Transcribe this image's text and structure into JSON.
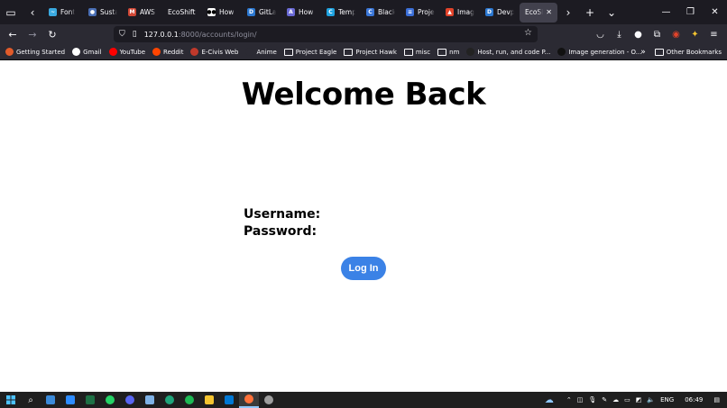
{
  "browser": {
    "tabs": [
      {
        "title": "Font",
        "color": "#3aa9e0",
        "glyph": "~"
      },
      {
        "title": "Susta",
        "color": "#4a6fb5",
        "glyph": "●"
      },
      {
        "title": "AWS I",
        "color": "#d14836",
        "glyph": "M"
      },
      {
        "title": "EcoShift",
        "color": "",
        "glyph": ""
      },
      {
        "title": "How t",
        "color": "#ffffff",
        "glyph": "●●"
      },
      {
        "title": "GitLal",
        "color": "#2c78d1",
        "glyph": "D"
      },
      {
        "title": "How t",
        "color": "#6a6ad6",
        "glyph": "A"
      },
      {
        "title": "Temp",
        "color": "#1fa3e0",
        "glyph": "C"
      },
      {
        "title": "Black",
        "color": "#3b77d8",
        "glyph": "C"
      },
      {
        "title": "Projec",
        "color": "#3b6fd8",
        "glyph": "≡"
      },
      {
        "title": "Imag",
        "color": "#e2432a",
        "glyph": "▲"
      },
      {
        "title": "Devp",
        "color": "#2c78d1",
        "glyph": "D"
      }
    ],
    "active_tab": {
      "title": "EcoShi",
      "close": "✕"
    },
    "url": {
      "host": "127.0.0.1",
      "path": ":8000/accounts/login/"
    },
    "bookmarks": [
      {
        "label": "Getting Started",
        "color": "#e25b2a",
        "type": "site"
      },
      {
        "label": "Gmail",
        "color": "#ffffff",
        "type": "site"
      },
      {
        "label": "YouTube",
        "color": "#ff0000",
        "type": "site"
      },
      {
        "label": "Reddit",
        "color": "#ff4500",
        "type": "site"
      },
      {
        "label": "E-Civis Web",
        "color": "#c0392b",
        "type": "site"
      },
      {
        "label": "Anime",
        "color": "#2b2a33",
        "type": "site"
      },
      {
        "label": "Project Eagle",
        "color": "",
        "type": "folder"
      },
      {
        "label": "Project Hawk",
        "color": "",
        "type": "folder"
      },
      {
        "label": "misc",
        "color": "",
        "type": "folder"
      },
      {
        "label": "nm",
        "color": "",
        "type": "folder"
      },
      {
        "label": "Host, run, and code P...",
        "color": "#222222",
        "type": "site"
      },
      {
        "label": "Image generation - O...",
        "color": "#111111",
        "type": "site"
      }
    ],
    "other_bookmarks": "Other Bookmarks"
  },
  "page": {
    "title": "Welcome Back",
    "username_label": "Username:",
    "password_label": "Password:",
    "login_button": "Log In"
  },
  "taskbar": {
    "apps": [
      {
        "name": "widgets",
        "color": "#3b8ad9"
      },
      {
        "name": "app-zoom",
        "color": "#2d8cff"
      },
      {
        "name": "excel",
        "color": "#1e7145"
      },
      {
        "name": "whatsapp",
        "color": "#25d366"
      },
      {
        "name": "discord",
        "color": "#5865f2"
      },
      {
        "name": "notepad",
        "color": "#7fb2e6"
      },
      {
        "name": "edge",
        "color": "#1fa57a"
      },
      {
        "name": "spotify",
        "color": "#1db954"
      },
      {
        "name": "explorer",
        "color": "#f4c430"
      },
      {
        "name": "vscode",
        "color": "#0078d4"
      },
      {
        "name": "firefox",
        "color": "#ff7139"
      },
      {
        "name": "settings",
        "color": "#9e9e9e"
      }
    ],
    "language": "ENG",
    "time": "06:49"
  }
}
